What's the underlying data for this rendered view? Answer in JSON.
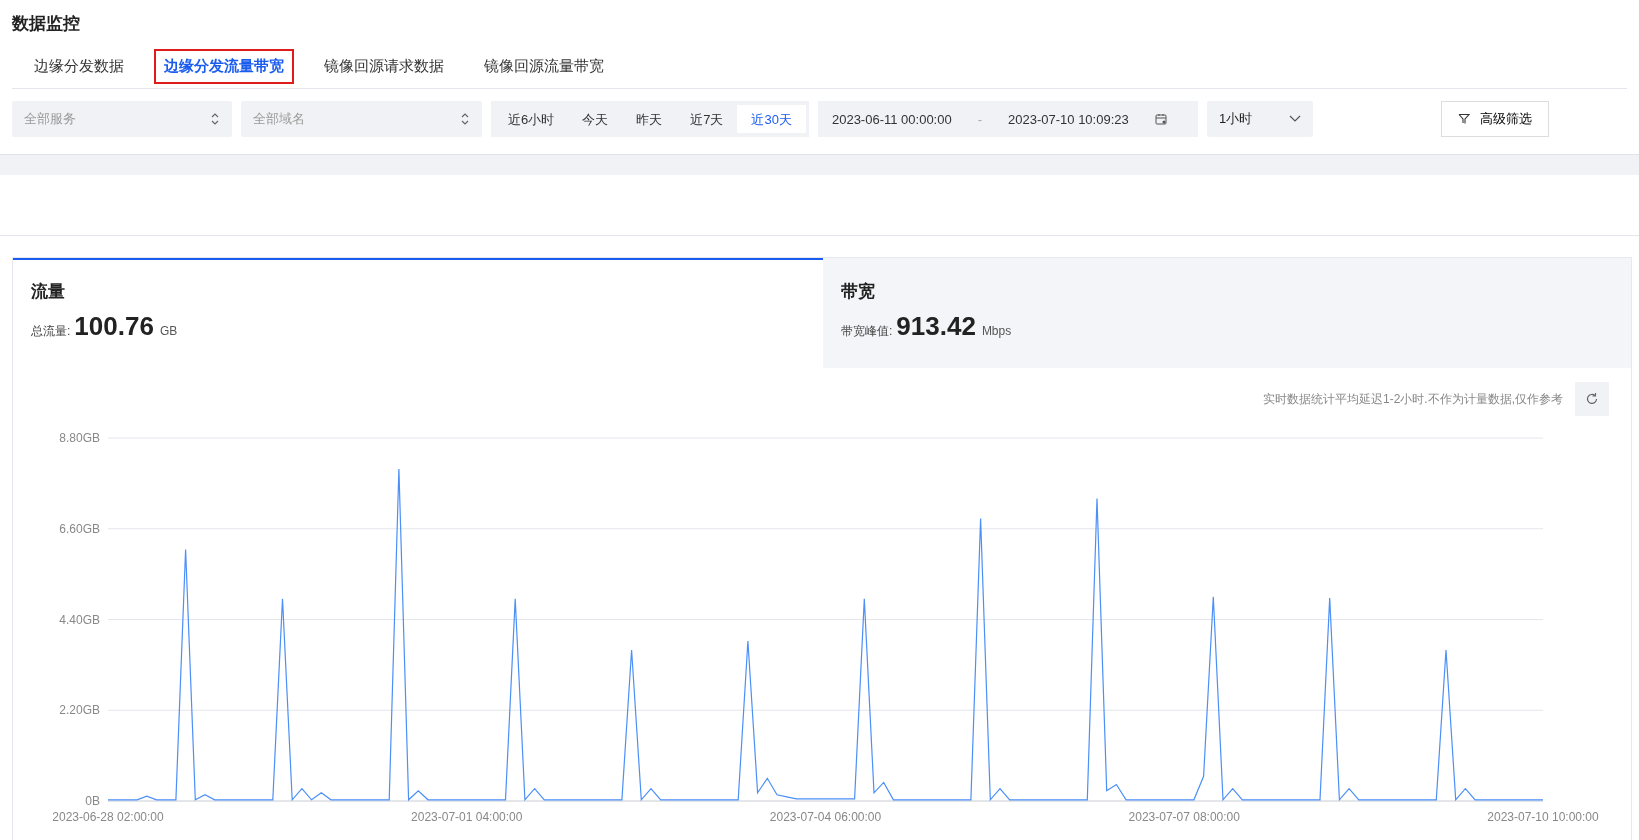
{
  "page_title": "数据监控",
  "tabs": [
    {
      "label": "边缘分发数据",
      "selected": false
    },
    {
      "label": "边缘分发流量带宽",
      "selected": true
    },
    {
      "label": "镜像回源请求数据",
      "selected": false
    },
    {
      "label": "镜像回源流量带宽",
      "selected": false
    }
  ],
  "filters": {
    "service": {
      "placeholder": "全部服务"
    },
    "domain": {
      "placeholder": "全部域名"
    },
    "ranges": [
      {
        "label": "近6小时",
        "selected": false
      },
      {
        "label": "今天",
        "selected": false
      },
      {
        "label": "昨天",
        "selected": false
      },
      {
        "label": "近7天",
        "selected": false
      },
      {
        "label": "近30天",
        "selected": true
      }
    ],
    "start": "2023-06-11 00:00:00",
    "separator": "-",
    "end": "2023-07-10 10:09:23",
    "granularity": "1小时",
    "advanced": "高级筛选"
  },
  "metrics": [
    {
      "title": "流量",
      "label": "总流量:",
      "value": "100.76",
      "unit": "GB",
      "selected": true
    },
    {
      "title": "带宽",
      "label": "带宽峰值:",
      "value": "913.42",
      "unit": "Mbps",
      "selected": false
    }
  ],
  "note": "实时数据统计平均延迟1-2小时.不作为计量数据,仅作参考",
  "chart_data": {
    "type": "line",
    "categories": [
      "2023-06-28 02:00:00",
      null,
      null,
      null,
      null,
      null,
      null,
      null,
      null,
      null,
      null,
      null,
      null,
      null,
      null,
      null,
      null,
      null,
      null,
      null,
      null,
      null,
      null,
      null,
      null,
      null,
      null,
      null,
      null,
      null,
      null,
      null,
      null,
      null,
      null,
      null,
      null,
      "2023-07-01 04:00:00",
      null,
      null,
      null,
      null,
      null,
      null,
      null,
      null,
      null,
      null,
      null,
      null,
      null,
      null,
      null,
      null,
      null,
      null,
      null,
      null,
      null,
      null,
      null,
      null,
      null,
      null,
      null,
      null,
      null,
      null,
      null,
      null,
      null,
      null,
      null,
      null,
      "2023-07-04 06:00:00",
      null,
      null,
      null,
      null,
      null,
      null,
      null,
      null,
      null,
      null,
      null,
      null,
      null,
      null,
      null,
      null,
      null,
      null,
      null,
      null,
      null,
      null,
      null,
      null,
      null,
      null,
      null,
      null,
      null,
      null,
      null,
      null,
      null,
      null,
      null,
      null,
      "2023-07-07 08:00:00",
      null,
      null,
      null,
      null,
      null,
      null,
      null,
      null,
      null,
      null,
      null,
      null,
      null,
      null,
      null,
      null,
      null,
      null,
      null,
      null,
      null,
      null,
      null,
      null,
      null,
      null,
      null,
      null,
      null,
      null,
      null,
      null,
      null,
      null,
      null,
      null,
      "2023-07-10 10:00:00"
    ],
    "series": [
      {
        "color": "#4b8ff7",
        "values": [
          0.03,
          0.03,
          0.03,
          0.03,
          0.12,
          0.03,
          0.03,
          0.03,
          6.1,
          0.03,
          0.15,
          0.03,
          0.03,
          0.03,
          0.03,
          0.03,
          0.03,
          0.03,
          4.9,
          0.03,
          0.3,
          0.03,
          0.2,
          0.03,
          0.03,
          0.03,
          0.03,
          0.03,
          0.03,
          0.03,
          8.05,
          0.03,
          0.25,
          0.03,
          0.03,
          0.03,
          0.03,
          0.03,
          0.03,
          0.03,
          0.03,
          0.03,
          4.9,
          0.03,
          0.3,
          0.03,
          0.03,
          0.03,
          0.03,
          0.03,
          0.03,
          0.03,
          0.03,
          0.03,
          3.66,
          0.03,
          0.3,
          0.03,
          0.03,
          0.03,
          0.03,
          0.03,
          0.03,
          0.03,
          0.03,
          0.03,
          3.88,
          0.2,
          0.55,
          0.15,
          0.1,
          0.05,
          0.05,
          0.05,
          0.05,
          0.05,
          0.05,
          0.05,
          4.9,
          0.2,
          0.45,
          0.03,
          0.03,
          0.03,
          0.03,
          0.03,
          0.03,
          0.03,
          0.03,
          0.03,
          6.85,
          0.03,
          0.3,
          0.03,
          0.03,
          0.03,
          0.03,
          0.03,
          0.03,
          0.03,
          0.03,
          0.03,
          7.33,
          0.25,
          0.4,
          0.03,
          0.03,
          0.03,
          0.03,
          0.03,
          0.03,
          0.03,
          0.03,
          0.6,
          4.95,
          0.03,
          0.3,
          0.03,
          0.03,
          0.03,
          0.03,
          0.03,
          0.03,
          0.03,
          0.03,
          0.03,
          4.92,
          0.03,
          0.3,
          0.03,
          0.03,
          0.03,
          0.03,
          0.03,
          0.03,
          0.03,
          0.03,
          0.03,
          3.66,
          0.03,
          0.3,
          0.03,
          0.03,
          0.03,
          0.03,
          0.03,
          0.03,
          0.03,
          0.03
        ]
      }
    ],
    "grid": true,
    "ylim": [
      0,
      8.8
    ],
    "yticks": [
      {
        "value": 0,
        "label": "0B"
      },
      {
        "value": 2.2,
        "label": "2.20GB"
      },
      {
        "value": 4.4,
        "label": "4.40GB"
      },
      {
        "value": 6.6,
        "label": "6.60GB"
      },
      {
        "value": 8.8,
        "label": "8.80GB"
      }
    ]
  }
}
